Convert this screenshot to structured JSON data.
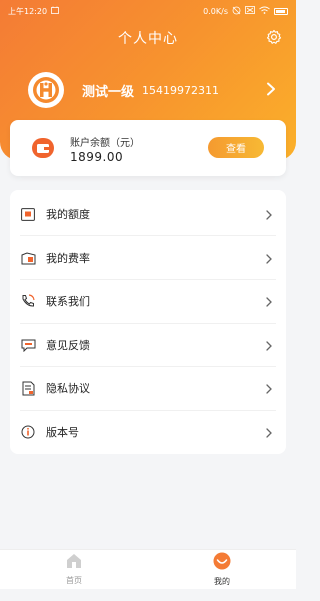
{
  "status_bar": {
    "time": "上午12:20",
    "network_speed": "0.0K/s"
  },
  "header": {
    "title": "个人中心"
  },
  "user": {
    "name": "测试一级",
    "phone": "15419972311"
  },
  "balance": {
    "label": "账户余额（元）",
    "value": "1899.00",
    "button_label": "查看"
  },
  "menu": {
    "items": [
      {
        "label": "我的额度",
        "icon": "quota-icon"
      },
      {
        "label": "我的费率",
        "icon": "rate-icon"
      },
      {
        "label": "联系我们",
        "icon": "phone-icon"
      },
      {
        "label": "意见反馈",
        "icon": "feedback-icon"
      },
      {
        "label": "隐私协议",
        "icon": "privacy-icon"
      },
      {
        "label": "版本号",
        "icon": "info-icon"
      }
    ]
  },
  "tabbar": {
    "tabs": [
      {
        "label": "首页",
        "icon": "home-icon",
        "active": false
      },
      {
        "label": "我的",
        "icon": "profile-icon",
        "active": true
      }
    ]
  },
  "colors": {
    "accent_orange": "#f47b35",
    "accent_yellow": "#fbb02a"
  }
}
